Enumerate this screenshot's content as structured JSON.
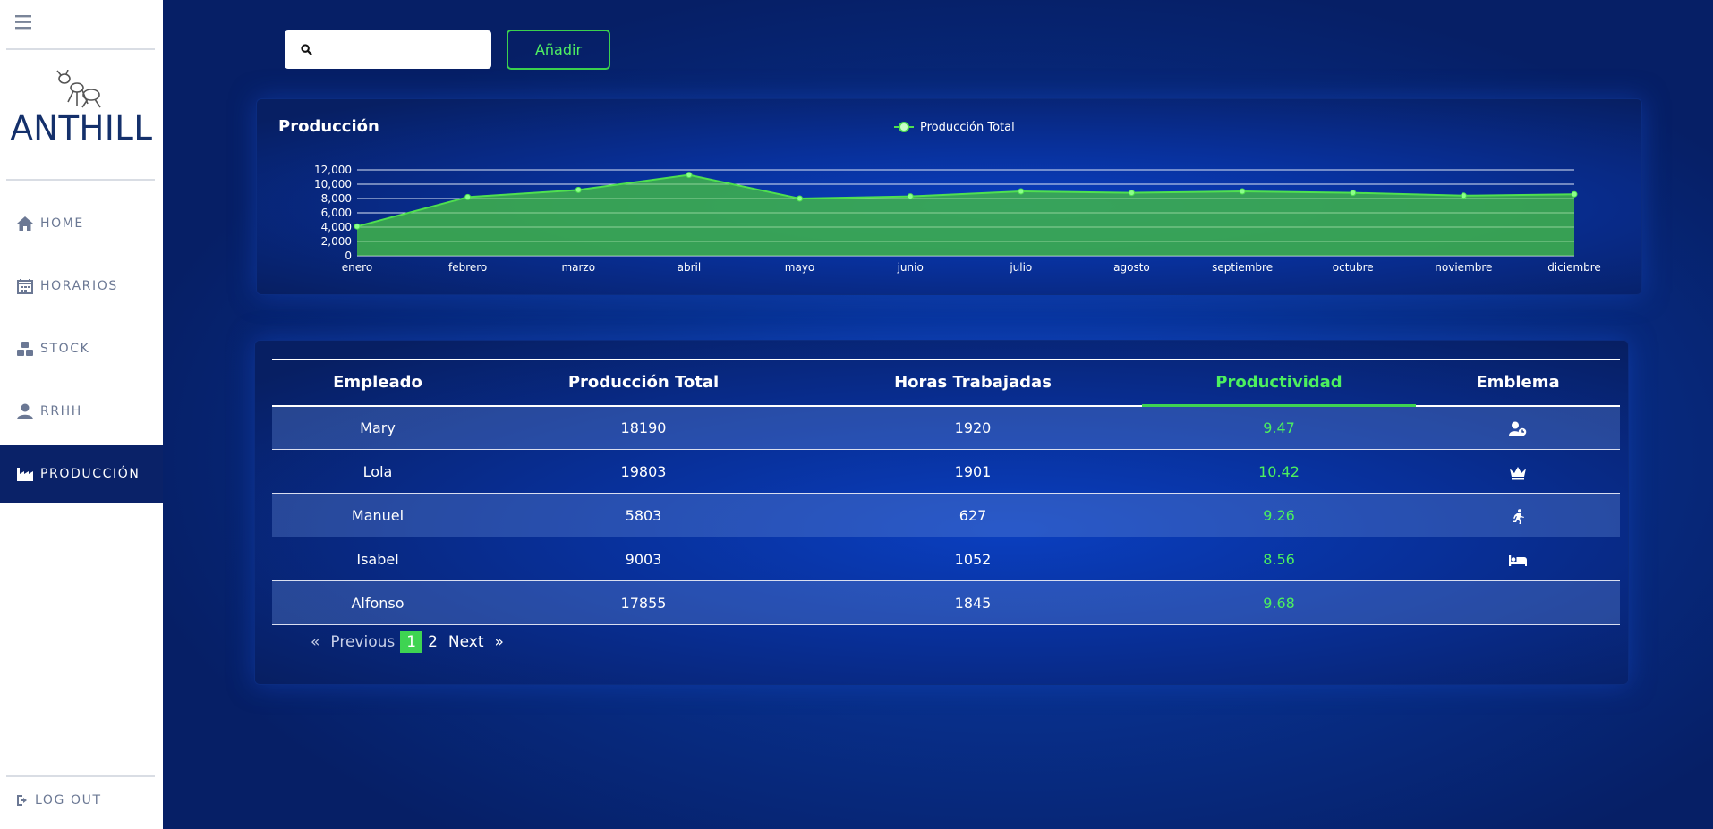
{
  "sidebar": {
    "brand": "ANTHILL",
    "items": [
      {
        "label": "HOME",
        "icon": "home-icon"
      },
      {
        "label": "HORARIOS",
        "icon": "calendar-icon"
      },
      {
        "label": "STOCK",
        "icon": "boxes-icon"
      },
      {
        "label": "RRHH",
        "icon": "user-icon"
      },
      {
        "label": "PRODUCCIÓN",
        "icon": "factory-icon",
        "active": true
      }
    ],
    "logout": "LOG OUT"
  },
  "toolbar": {
    "search_placeholder": "",
    "add_label": "Añadir"
  },
  "chart": {
    "title": "Producción",
    "legend": "Producción Total"
  },
  "chart_data": {
    "type": "area",
    "title": "Producción",
    "categories": [
      "enero",
      "febrero",
      "marzo",
      "abril",
      "mayo",
      "junio",
      "julio",
      "agosto",
      "septiembre",
      "octubre",
      "noviembre",
      "diciembre"
    ],
    "series": [
      {
        "name": "Producción Total",
        "values": [
          4100,
          8200,
          9200,
          11300,
          8000,
          8300,
          9000,
          8800,
          9000,
          8800,
          8400,
          8600
        ]
      }
    ],
    "yticks": [
      "0",
      "2,000",
      "4,000",
      "6,000",
      "8,000",
      "10,000",
      "12,000"
    ],
    "ylim": [
      0,
      12000
    ],
    "grid": true,
    "legend_position": "top-center",
    "colors": {
      "line": "#4fe04f",
      "fill": "#3fb54a",
      "grid": "#c9d7f2"
    }
  },
  "table": {
    "headers": [
      "Empleado",
      "Producción Total",
      "Horas Trabajadas",
      "Productividad",
      "Emblema"
    ],
    "rows": [
      {
        "name": "Mary",
        "total": "18190",
        "hours": "1920",
        "prod": "9.47",
        "emblem": "user-clock-icon"
      },
      {
        "name": "Lola",
        "total": "19803",
        "hours": "1901",
        "prod": "10.42",
        "emblem": "crown-icon"
      },
      {
        "name": "Manuel",
        "total": "5803",
        "hours": "627",
        "prod": "9.26",
        "emblem": "running-icon"
      },
      {
        "name": "Isabel",
        "total": "9003",
        "hours": "1052",
        "prod": "8.56",
        "emblem": "bed-icon"
      },
      {
        "name": "Alfonso",
        "total": "17855",
        "hours": "1845",
        "prod": "9.68",
        "emblem": ""
      }
    ]
  },
  "pager": {
    "prev_arrow": "«",
    "prev": "Previous",
    "pages": [
      "1",
      "2"
    ],
    "next": "Next",
    "next_arrow": "»"
  }
}
